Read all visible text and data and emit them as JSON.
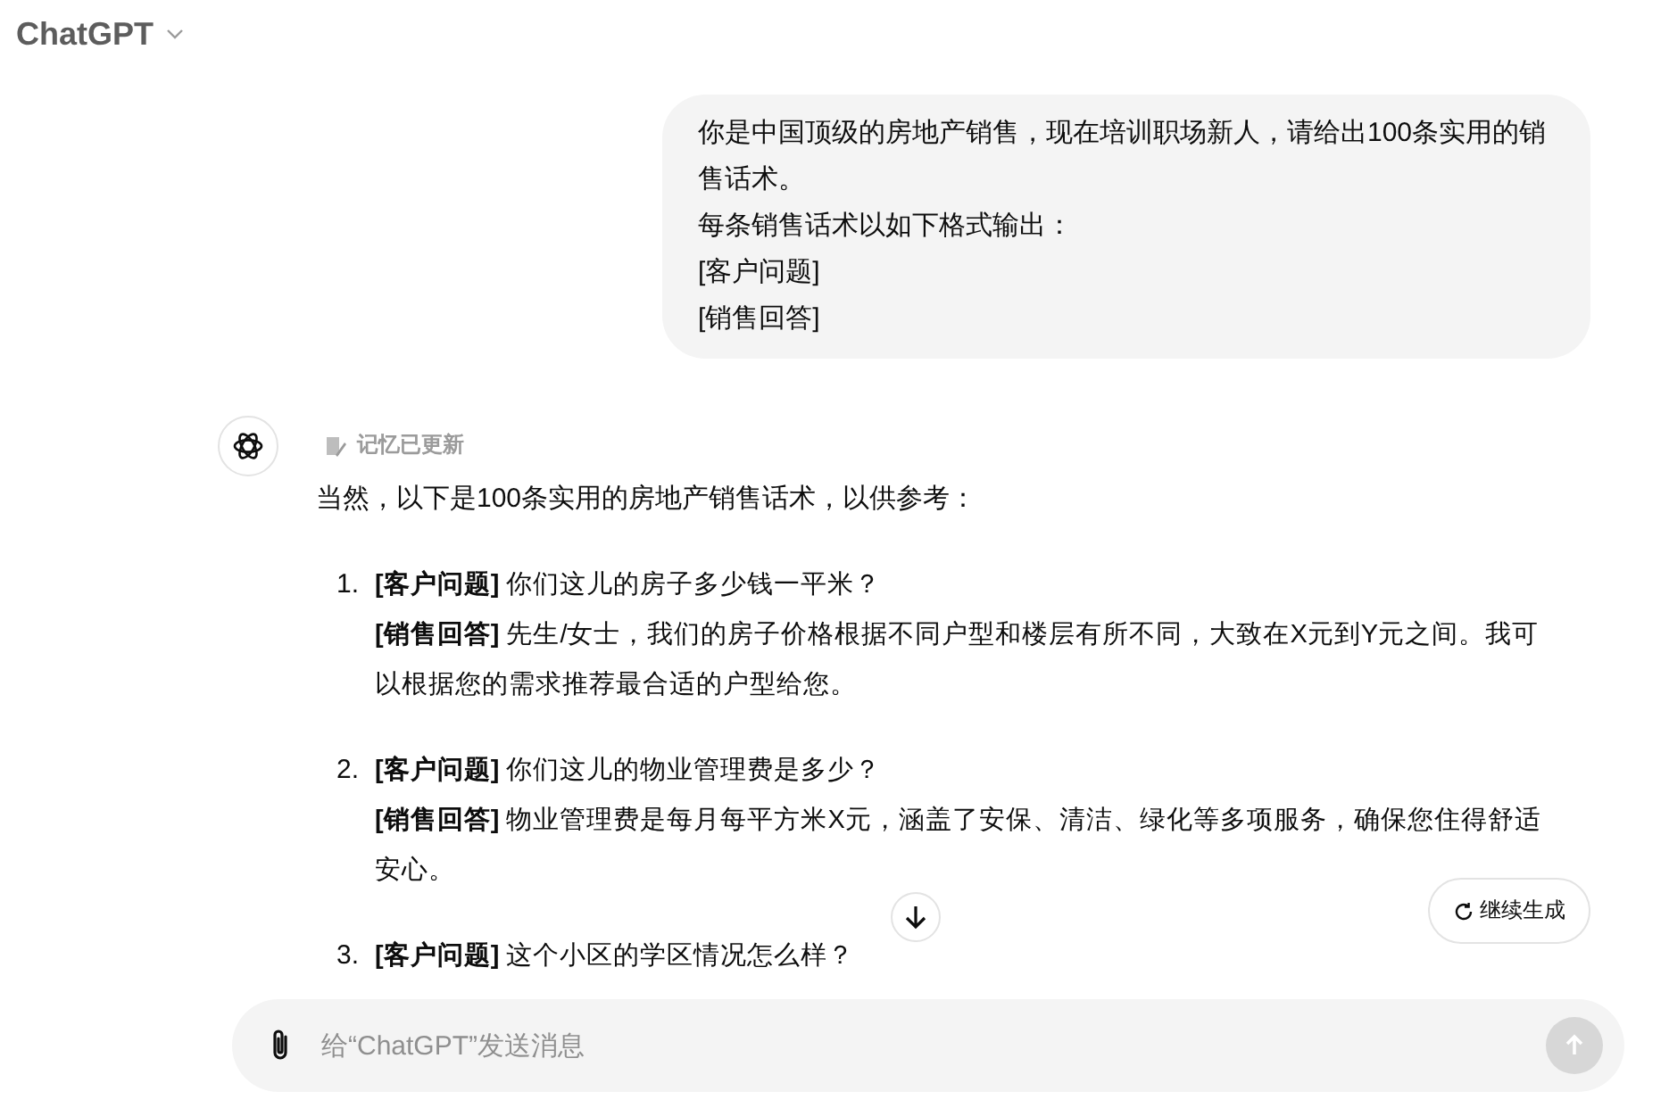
{
  "header": {
    "title": "ChatGPT"
  },
  "messages": [
    {
      "kind": "user",
      "lines": [
        "你是中国顶级的房地产销售，现在培训职场新人，请给出100条实用的销售话术。",
        "每条销售话术以如下格式输出：",
        "[客户问题]",
        "[销售回答]"
      ]
    },
    {
      "kind": "assistant",
      "memory_note": "记忆已更新",
      "intro": "当然，以下是100条实用的房地产销售话术，以供参考：",
      "items": [
        {
          "number": "1.",
          "question": "**[客户问题]** 你们这儿的房子多少钱一平米？",
          "answer": "**[销售回答]** 先生/女士，我们的房子价格根据不同户型和楼层有所不同，大致在X元到Y元之间。我可以根据您的需求推荐最合适的户型给您。"
        },
        {
          "number": "2.",
          "question": "**[客户问题]** 你们这儿的物业管理费是多少？",
          "answer": "**[销售回答]** 物业管理费是每月每平方米X元，涵盖了安保、清洁、绿化等多项服务，确保您住得舒适安心。"
        },
        {
          "number": "3.",
          "question": "**[客户问题]** 这个小区的学区情况怎么样？"
        }
      ]
    }
  ],
  "continue_button": {
    "label": "继续生成"
  },
  "composer": {
    "placeholder": "给“ChatGPT”发送消息"
  }
}
